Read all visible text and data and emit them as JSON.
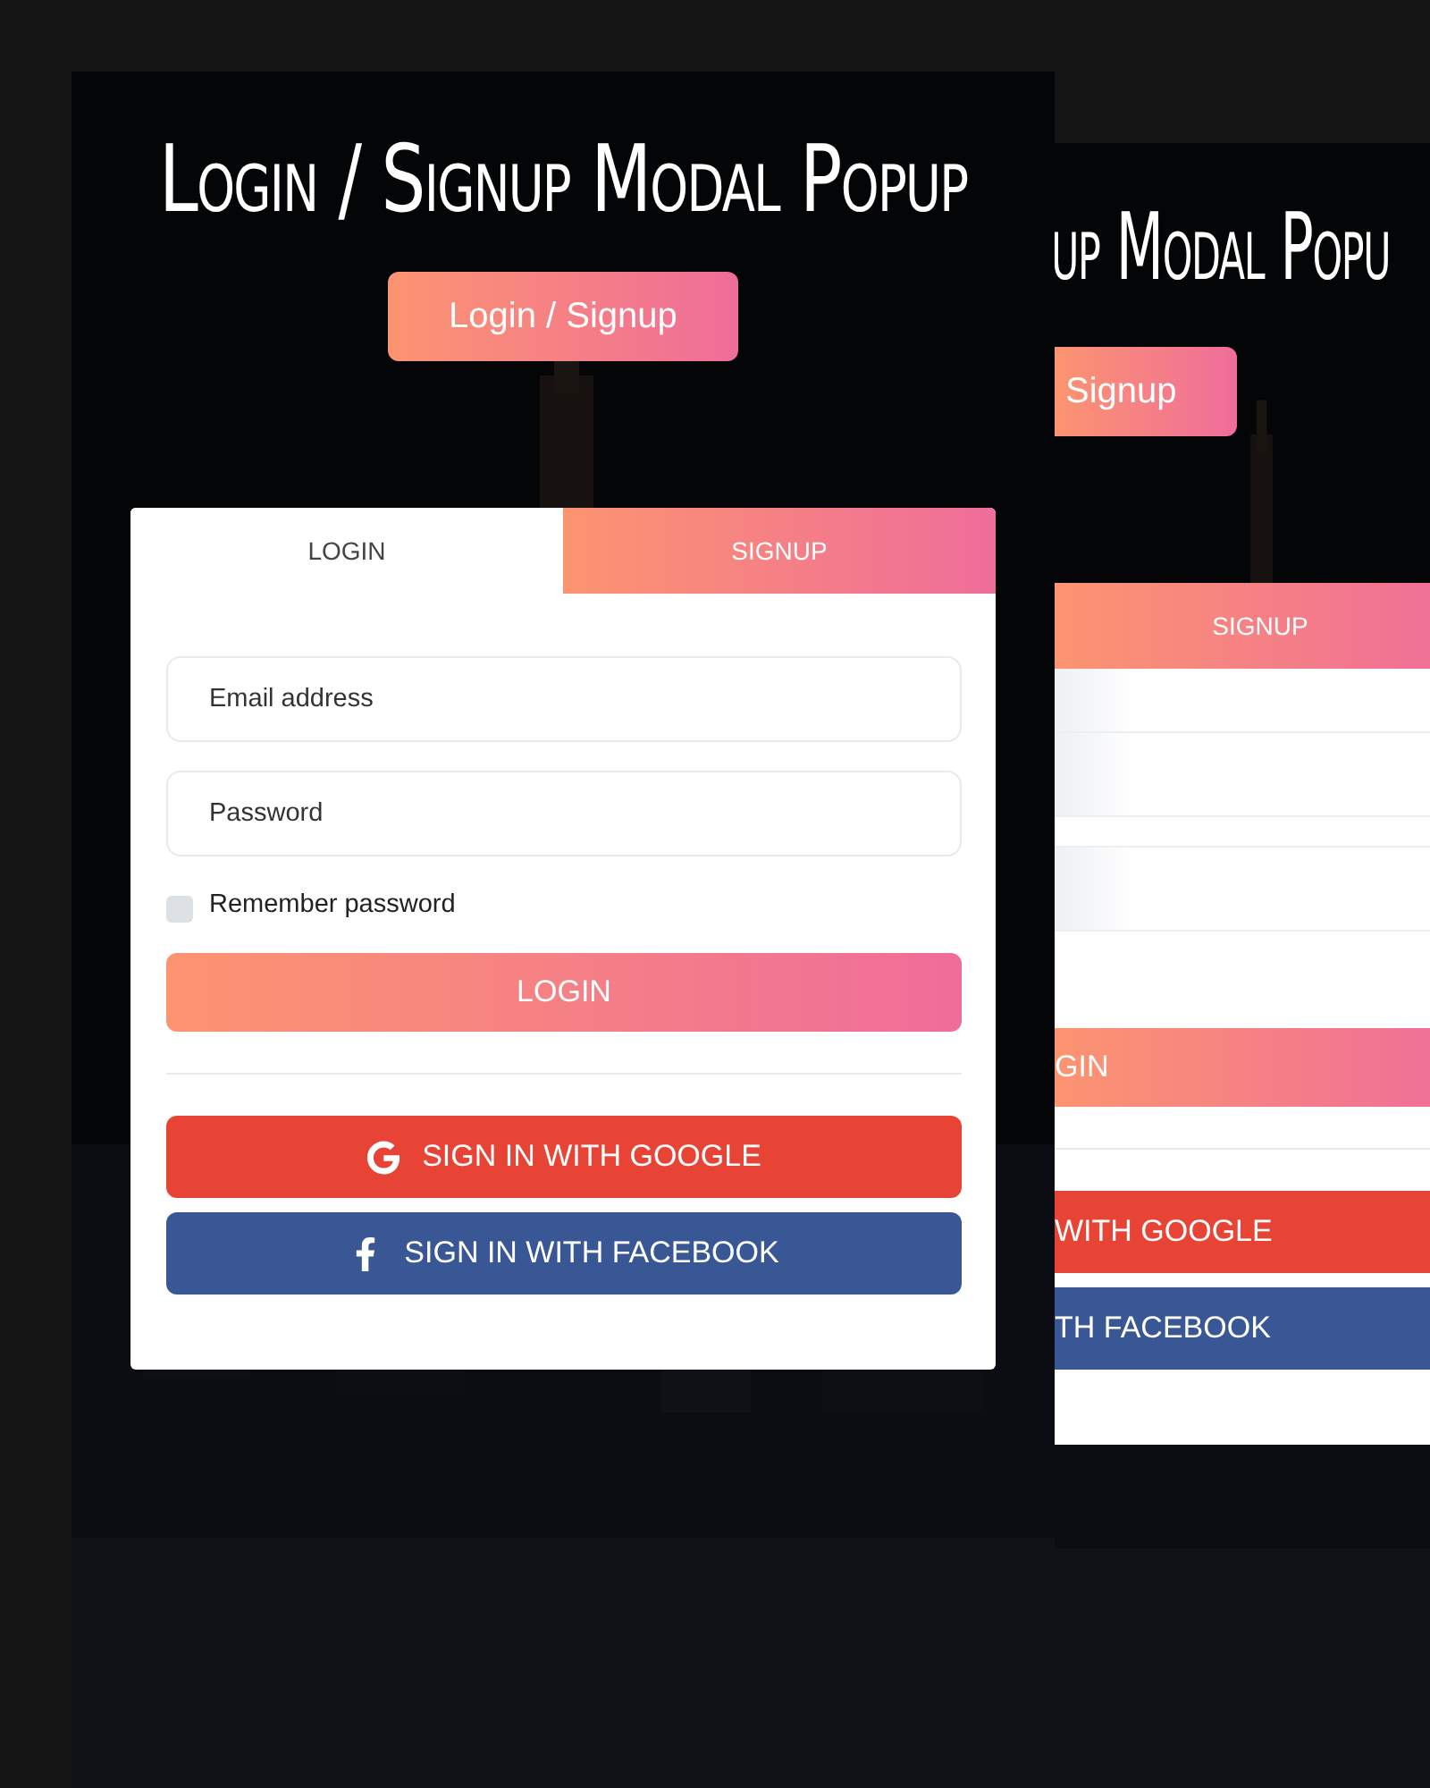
{
  "front": {
    "title": "Login / Signup Modal Popup",
    "open_button": "Login / Signup",
    "tabs": [
      {
        "label": "LOGIN",
        "selected": true
      },
      {
        "label": "SIGNUP",
        "selected": false
      }
    ],
    "fields": [
      {
        "placeholder": "Email address"
      },
      {
        "placeholder": "Password"
      }
    ],
    "remember": {
      "label": "Remember password",
      "checked": false
    },
    "submit": "LOGIN",
    "social": [
      {
        "kind": "google",
        "label": "SIGN IN WITH GOOGLE"
      },
      {
        "kind": "facebook",
        "label": "SIGN IN WITH FACEBOOK"
      }
    ]
  },
  "back": {
    "title": "up Modal Popu",
    "open_button": "Signup",
    "tabs": [
      {
        "label": "SIGNUP",
        "selected": false
      }
    ],
    "submit": "GIN",
    "social": [
      {
        "kind": "google",
        "label": "WITH GOOGLE"
      },
      {
        "kind": "facebook",
        "label": "TH FACEBOOK"
      }
    ]
  }
}
